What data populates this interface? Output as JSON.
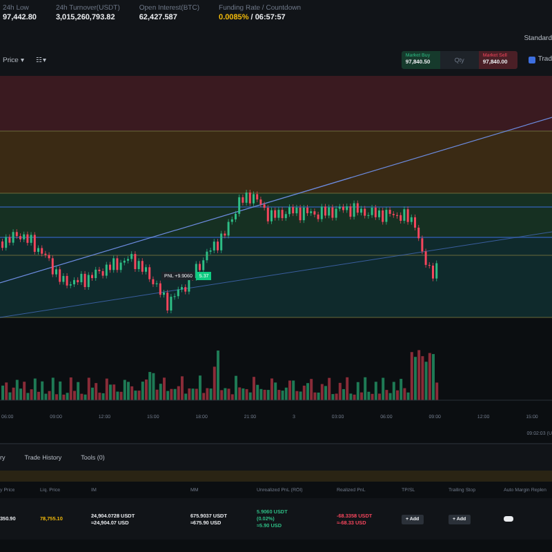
{
  "stats": [
    {
      "label": "24h Low",
      "value": "97,442.80"
    },
    {
      "label": "24h Turnover(USDT)",
      "value": "3,015,260,793.82"
    },
    {
      "label": "Open Interest(BTC)",
      "value": "62,427.587"
    },
    {
      "label": "Funding Rate / Countdown",
      "value": "0.0085%",
      "extra": "/ 06:57:57"
    }
  ],
  "view_mode": "Standard",
  "toolbar": [
    {
      "label": "Price ▾"
    },
    {
      "label": "☷ ▾"
    }
  ],
  "market": {
    "buy_label": "Market Buy",
    "buy_price": "97,840.50",
    "qty": "Qty",
    "sell_label": "Market Sell",
    "sell_price": "97,840.00"
  },
  "trading_toggle": {
    "label": "Trad",
    "checked": true
  },
  "position_label": {
    "text": "PNL +9.9060",
    "qty": "5.37"
  },
  "time_axis": [
    "06:00",
    "09:00",
    "12:00",
    "15:00",
    "18:00",
    "21:00",
    "3",
    "03:00",
    "06:00",
    "09:00",
    "12:00",
    "15:00"
  ],
  "clock": "09:02:03 (U",
  "tabs": [
    {
      "label": "ry",
      "selected": false
    },
    {
      "label": "Trade History",
      "selected": false
    },
    {
      "label": "Tools (0)",
      "selected": false
    }
  ],
  "columns": [
    "y Price",
    "Liq. Price",
    "IM",
    "MM",
    "Unrealized PnL (ROI)",
    "Realized PnL",
    "TP/SL",
    "Trailing Stop",
    "Auto Margin Replen"
  ],
  "row": {
    "entry": "350.90",
    "liq": "78,755.10",
    "im": [
      "24,904.0728 USDT",
      "≈24,904.07 USD"
    ],
    "mm": [
      "675.9037 USDT",
      "≈675.90 USD"
    ],
    "upnl": [
      "5.9060 USDT",
      "(0.02%)",
      "≈5.90 USD"
    ],
    "rpnl": [
      "-68.3358 USDT",
      "≈-68.33 USD"
    ],
    "tpsl": "+ Add",
    "trailing": "+ Add",
    "auto_margin": false
  }
}
